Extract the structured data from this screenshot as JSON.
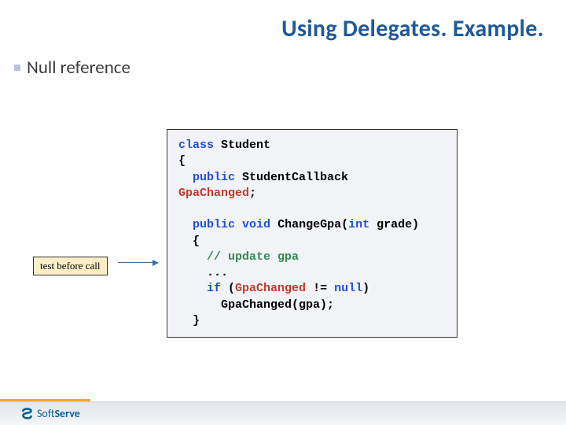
{
  "title": "Using Delegates. Example.",
  "bullet": "Null reference",
  "annotation": "test before call",
  "code": {
    "l1a": "class",
    "l1b": " Student",
    "l2": "{",
    "l3a": "  ",
    "l3b": "public",
    "l3c": " StudentCallback ",
    "l4": "GpaChanged",
    "l4b": ";",
    "blank": "",
    "l5a": "  ",
    "l5b": "public",
    "l5c": " ",
    "l5d": "void",
    "l5e": " ChangeGpa(",
    "l5f": "int",
    "l5g": " grade)",
    "l6": "  {",
    "l7a": "    ",
    "l7b": "// update gpa",
    "l8": "    ...",
    "l9a": "    ",
    "l9b": "if",
    "l9c": " (",
    "l9d": "GpaChanged",
    "l9e": " != ",
    "l9f": "null",
    "l9g": ")",
    "l10": "      GpaChanged(gpa);",
    "l11": "  }"
  },
  "footer": {
    "brand_a": "Soft",
    "brand_b": "Serve"
  }
}
